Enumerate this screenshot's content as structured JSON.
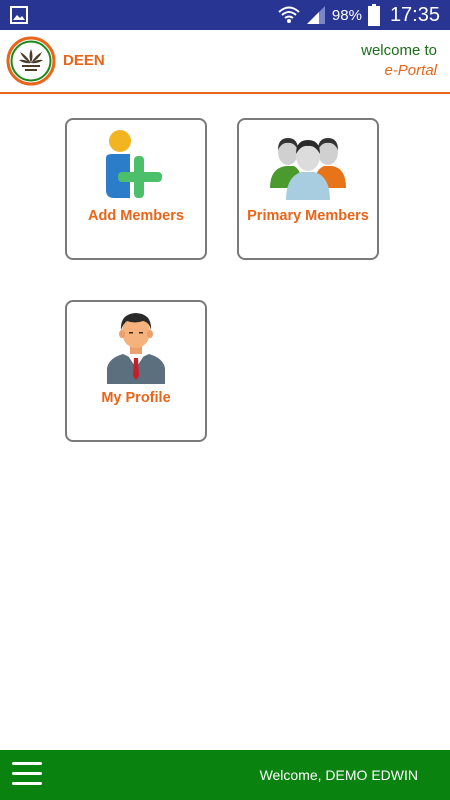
{
  "status_bar": {
    "battery": "98%",
    "time": "17:35",
    "icons": [
      "gallery-icon",
      "wifi-icon",
      "signal-icon",
      "battery-icon"
    ]
  },
  "header": {
    "brand": "DEEN",
    "welcome_line1": "welcome to",
    "welcome_line2": "e-Portal",
    "logo": "lotus-logo-icon"
  },
  "tiles": [
    {
      "label": "Add Members",
      "icon": "add-member-icon"
    },
    {
      "label": "Primary Members",
      "icon": "group-members-icon"
    },
    {
      "label": "My Profile",
      "icon": "profile-avatar-icon"
    }
  ],
  "bottom_bar": {
    "welcome": "Welcome, DEMO EDWIN",
    "menu_icon": "hamburger-menu-icon"
  },
  "colors": {
    "status_bar": "#283593",
    "accent_orange": "#e8651a",
    "welcome_green": "#1b6e1b",
    "bottom_bar": "#0a8210"
  }
}
